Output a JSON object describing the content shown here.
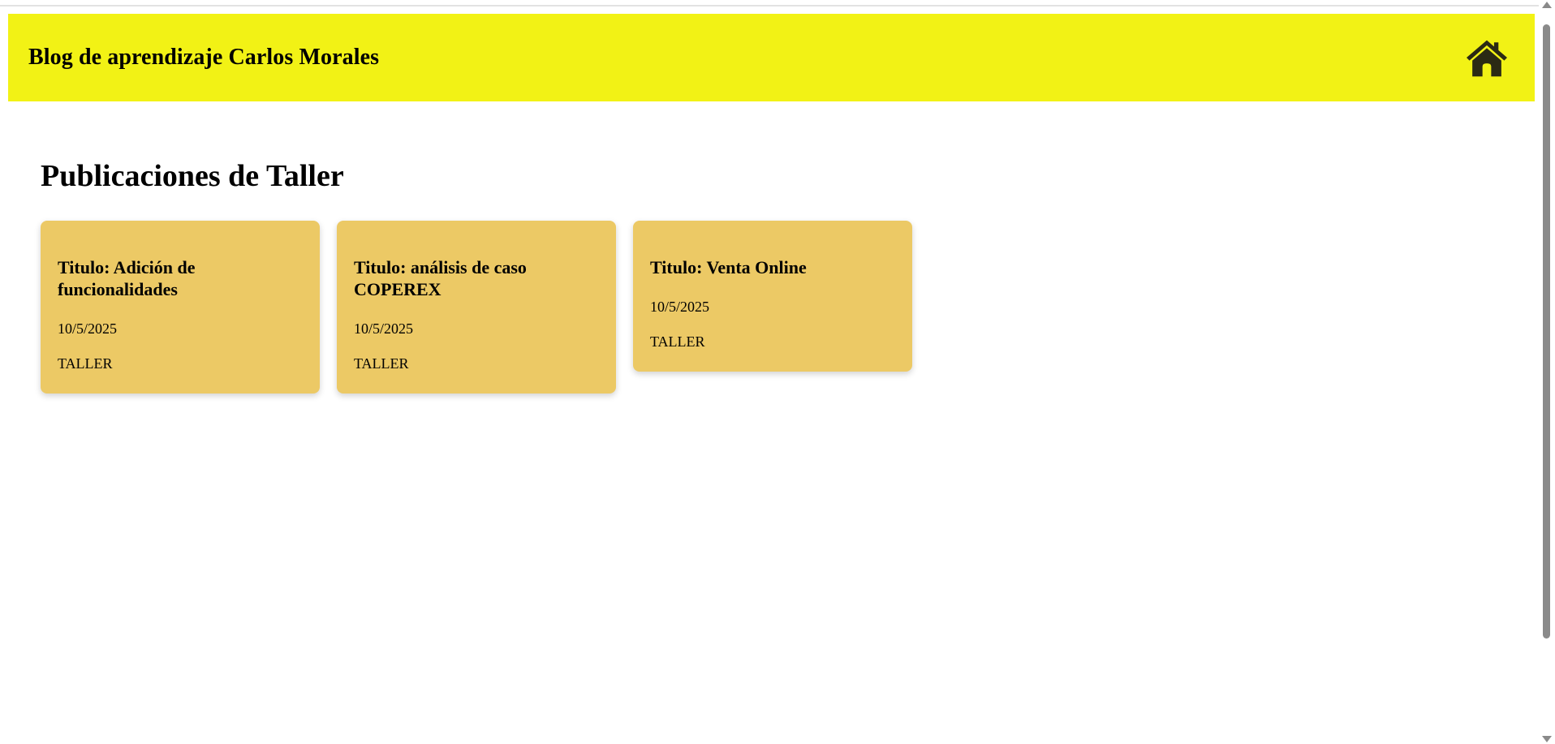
{
  "header": {
    "title": "Blog de aprendizaje Carlos Morales",
    "home_icon": "home-icon",
    "background_color": "#f2f215"
  },
  "main": {
    "section_title": "Publicaciones de Taller",
    "cards": [
      {
        "title": "Titulo: Adición de funcionalidades",
        "date": "10/5/2025",
        "category": "TALLER"
      },
      {
        "title": "Titulo: análisis de caso COPEREX",
        "date": "10/5/2025",
        "category": "TALLER"
      },
      {
        "title": "Titulo: Venta Online",
        "date": "10/5/2025",
        "category": "TALLER"
      }
    ],
    "card_color": "#ecc965"
  }
}
